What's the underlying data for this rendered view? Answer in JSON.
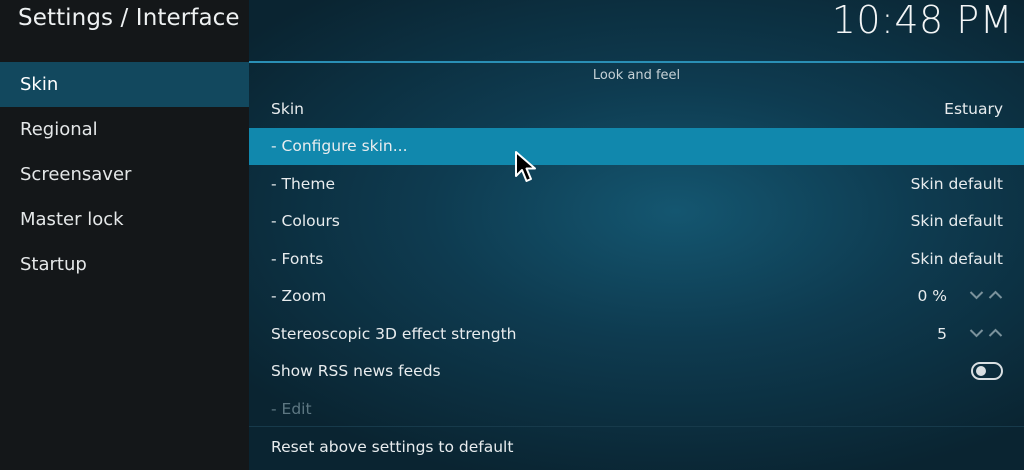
{
  "window": {
    "title": "Settings / Interface",
    "clock": "10:48 PM"
  },
  "sidebar": {
    "items": [
      {
        "label": "Skin",
        "selected": true
      },
      {
        "label": "Regional"
      },
      {
        "label": "Screensaver"
      },
      {
        "label": "Master lock"
      },
      {
        "label": "Startup"
      }
    ]
  },
  "main": {
    "section_title": "Look and feel",
    "rows": [
      {
        "label": "Skin",
        "value": "Estuary"
      },
      {
        "label": "- Configure skin...",
        "value": ""
      },
      {
        "label": "- Theme",
        "value": "Skin default"
      },
      {
        "label": "- Colours",
        "value": "Skin default"
      },
      {
        "label": "- Fonts",
        "value": "Skin default"
      },
      {
        "label": "- Zoom",
        "value": "0 %"
      },
      {
        "label": "Stereoscopic 3D effect strength",
        "value": "5"
      },
      {
        "label": "Show RSS news feeds",
        "toggle_on": false
      },
      {
        "label": "- Edit",
        "disabled": true
      }
    ],
    "reset_label": "Reset above settings to default"
  },
  "icons": {
    "spin_down": "chevron-down-icon",
    "spin_up": "chevron-up-icon",
    "cursor": "mouse-pointer-icon"
  },
  "colors": {
    "accent": "#1188ad",
    "sidebar_selected": "#12485e",
    "header_line": "#2a8fb5"
  }
}
